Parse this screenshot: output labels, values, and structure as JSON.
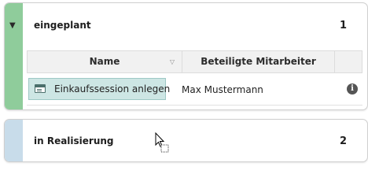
{
  "colors": {
    "panel1_stripe": "#8fcc9b",
    "panel2_stripe": "#c8dcea",
    "selected_cell_bg": "#cde6e4"
  },
  "panels": [
    {
      "title": "eingeplant",
      "count": "1",
      "expanded": true,
      "toggle_icon": "triangle-down-icon",
      "table": {
        "columns": [
          "Name",
          "Beteiligte Mitarbeiter",
          ""
        ],
        "sort_icon": "sort-indicator-icon",
        "rows": [
          {
            "name": "Einkaufssession anlegen",
            "name_icon": "document-icon",
            "members": "Max Mustermann",
            "action_icon": "info-icon"
          }
        ]
      }
    },
    {
      "title": "in Realisierung",
      "count": "2",
      "expanded": false
    }
  ],
  "cursor": "mouse-pointer-busy-icon"
}
